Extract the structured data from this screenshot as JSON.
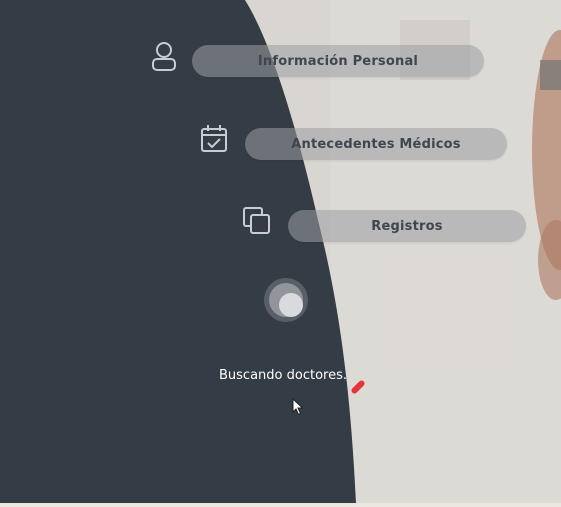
{
  "nav": {
    "items": [
      {
        "label": "Información Personal",
        "icon": "user-icon"
      },
      {
        "label": "Antecedentes Médicos",
        "icon": "calendar-check-icon"
      },
      {
        "label": "Registros",
        "icon": "copy-icon"
      }
    ]
  },
  "status": {
    "text": "Buscando doctores."
  },
  "colors": {
    "panel": "#343b46",
    "pill": "#9c9ea2",
    "pill_text": "#3f4650",
    "marker": "#e8323a"
  }
}
